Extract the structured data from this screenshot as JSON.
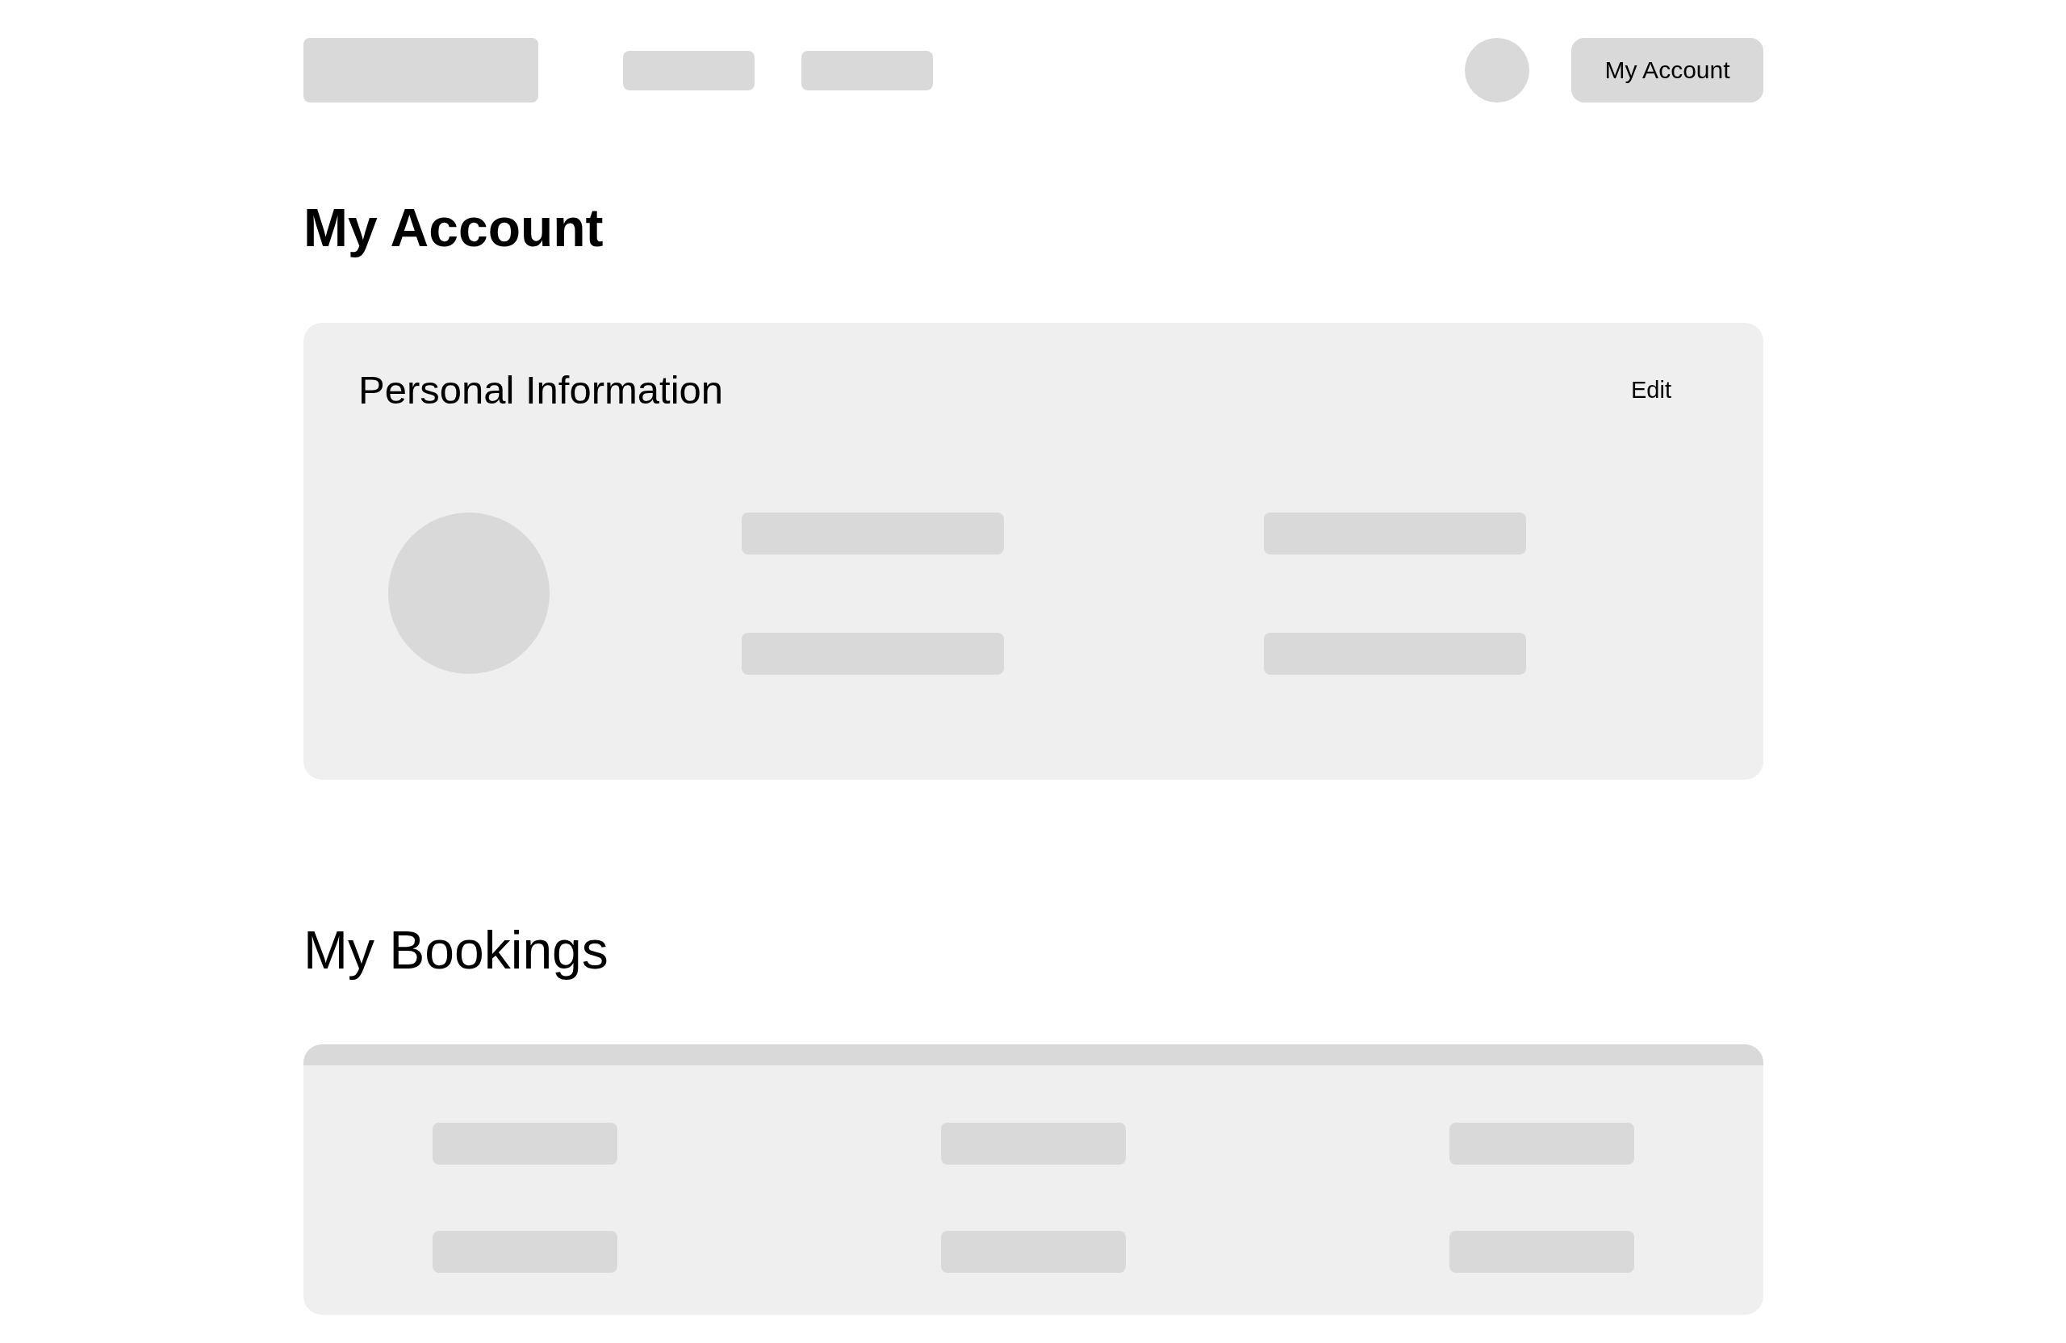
{
  "header": {
    "account_button": "My Account"
  },
  "page_title": "My Account",
  "personal_information": {
    "title": "Personal Information",
    "edit": "Edit"
  },
  "bookings": {
    "title": "My Bookings"
  }
}
